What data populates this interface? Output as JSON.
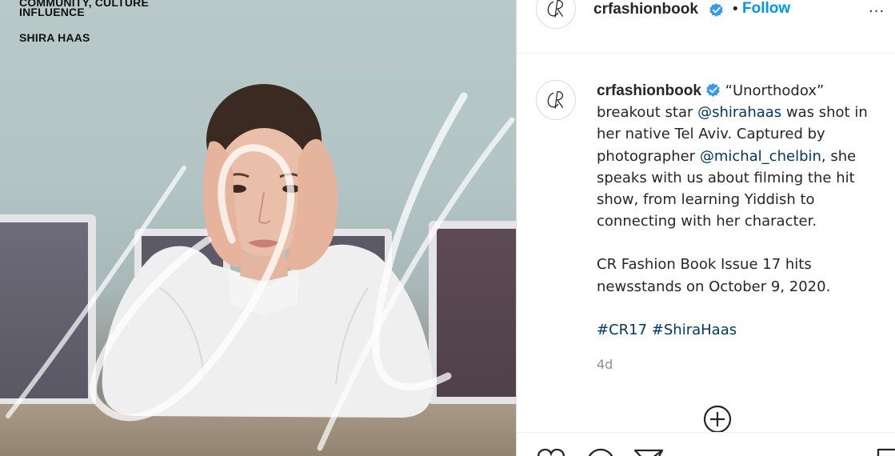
{
  "photo": {
    "overlay_lines": [
      "COMMUNITY, CULTURE",
      "INFLUENCE",
      "SHIRA HAAS"
    ]
  },
  "header": {
    "avatar_initials": "CR",
    "username": "crfashionbook",
    "verified_icon": "verified-badge-icon",
    "separator": "•",
    "follow_label": "Follow",
    "more_label": "···"
  },
  "caption": {
    "username": "crfashionbook",
    "text_1": " “Unorthodox” breakout star ",
    "mention_1": "@shirahaas",
    "text_2": " was shot in her native Tel Aviv. Captured by photographer ",
    "mention_2": "@michal_chelbin",
    "text_3": ", she speaks with us about filming the hit show, from learning Yiddish to connecting with her character.",
    "paragraph_2": "CR Fashion Book Issue 17 hits newsstands on October 9, 2020.",
    "hashtag_1": "#CR17",
    "hashtag_2": "#ShiraHaas",
    "timestamp": "4d"
  },
  "colors": {
    "link": "#00376b",
    "follow": "#0095f6",
    "verified": "#3897f0",
    "muted": "#8e8e8e"
  },
  "icons": [
    "heart-icon",
    "comment-icon",
    "share-icon",
    "bookmark-icon",
    "add-comment-icon"
  ]
}
